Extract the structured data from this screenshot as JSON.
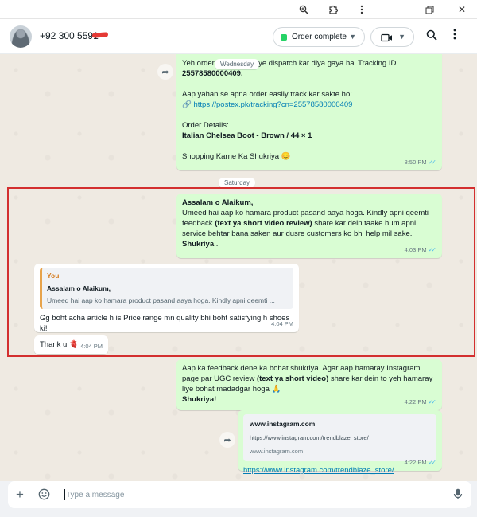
{
  "window": {
    "icons": [
      "zoom-icon",
      "extensions-icon",
      "more-vert-icon",
      "restore-icon",
      "close-icon"
    ],
    "close_glyph": "✕"
  },
  "header": {
    "contact_name": "+92 300 5591",
    "order_status": "Order complete",
    "status_color": "#25d366"
  },
  "chat": {
    "msg1": {
      "line1_start": "Yeh order",
      "line1_end": "riye dispatch kar diya gaya hai Tracking ID",
      "tracking_id": "25578580000409.",
      "intro": "Aap yahan se apna order easily track kar sakte ho:",
      "link_prefix": "🔗",
      "link": "https://postex.pk/tracking?cn=25578580000409",
      "details_label": "Order Details:",
      "product": "Italian Chelsea Boot - Brown / 44 × 1",
      "thanks": "Shopping Karne Ka Shukriya 😊",
      "time": "8:50 PM"
    },
    "date_wednesday": "Wednesday",
    "date_saturday": "Saturday",
    "msg2": {
      "greeting": "Assalam o Alaikum,",
      "line1": "Umeed hai aap ko hamara product pasand aaya hoga. Kindly apni qeemti",
      "line2_start": "feedback ",
      "line2_bold": "(text ya short video review)",
      "line2_end": " share kar dein taake hum apni",
      "line3": "service behtar bana saken aur dusre customers ko bhi help mil sake.",
      "closing": "Shukriya",
      "closing_dot": " .",
      "time": "4:03 PM"
    },
    "msg3": {
      "quote_author": "You",
      "quote_title": "Assalam o Alaikum,",
      "quote_text": "Umeed hai aap ko hamara product pasand aaya hoga. Kindly apni qeemti ...",
      "line1": "Gg boht acha article h is Price range mn quality bhi boht satisfying h shoes",
      "line2": "ki!",
      "time": "4:04 PM"
    },
    "msg4": {
      "text": "Thank u 🫀",
      "time": "4:04 PM"
    },
    "msg5": {
      "line1": "Aap ka feedback dene ka bohat shukriya. Agar aap hamaray Instagram",
      "line2_start": "page par UGC review ",
      "line2_bold": "(text ya short video)",
      "line2_end": " share kar dein to yeh hamaray",
      "line3": "liye bohat madadgar hoga 🙏",
      "closing": "Shukriya!",
      "time": "4:22 PM"
    },
    "msg6": {
      "preview_title": "www.instagram.com",
      "preview_url": "https://www.instagram.com/trendblaze_store/",
      "preview_domain": "www.instagram.com",
      "link": "https://www.instagram.com/trendblaze_store/",
      "time": "4:22 PM"
    },
    "tick_glyph": "✓✓",
    "forward_glyph": "➦"
  },
  "composer": {
    "placeholder": "Type a message",
    "value": ""
  }
}
